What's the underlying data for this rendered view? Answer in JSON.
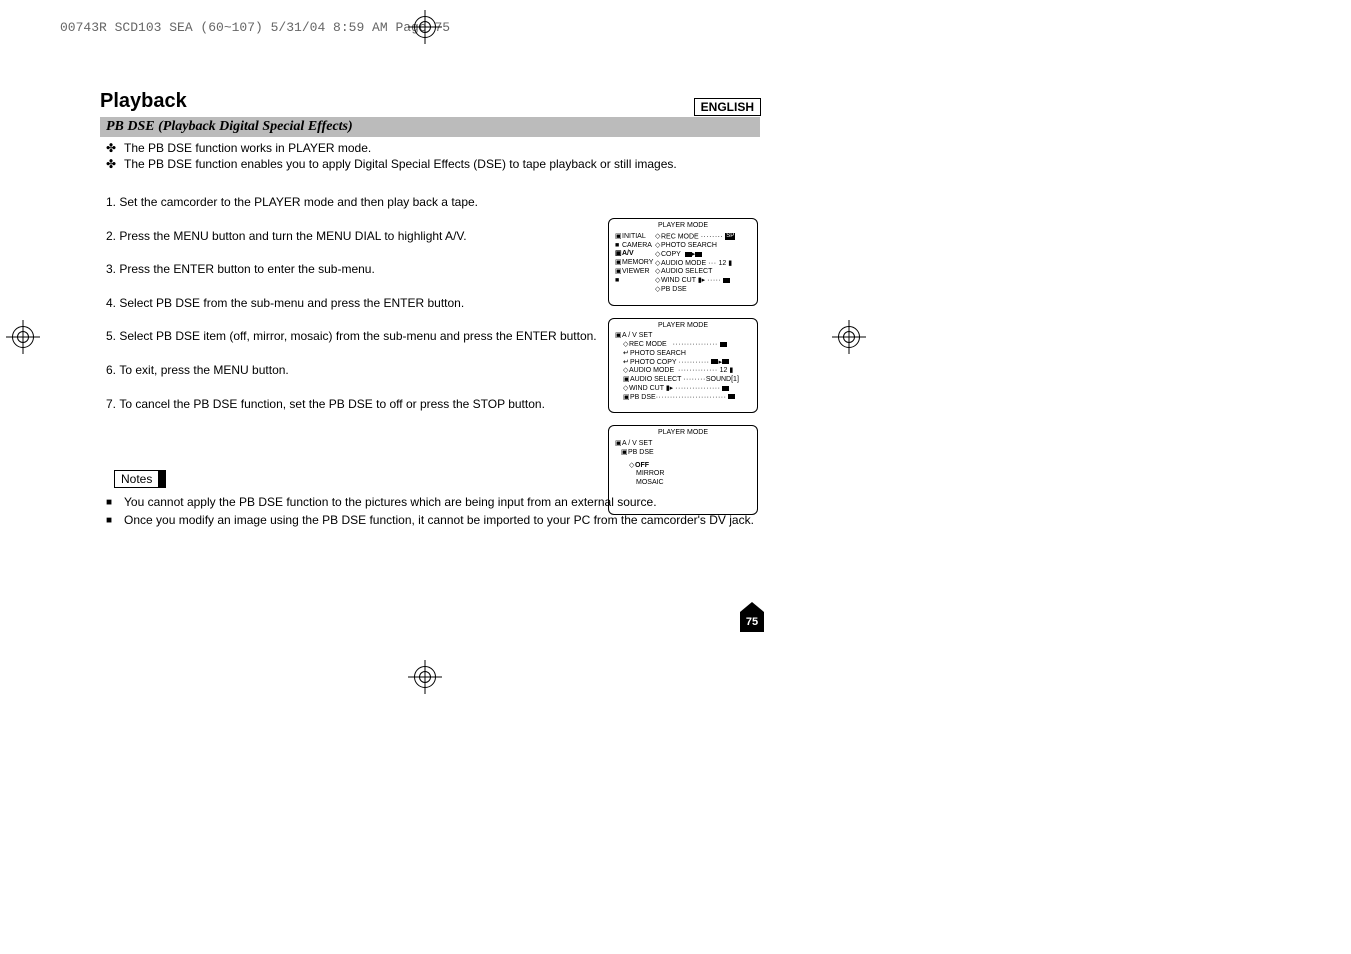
{
  "slug": "00743R SCD103 SEA (60~107)  5/31/04 8:59 AM  Page 75",
  "language": "ENGLISH",
  "page_title": "Playback",
  "sub_header": "PB DSE (Playback Digital Special Effects)",
  "intro": [
    "The PB DSE function works in PLAYER mode.",
    "The PB DSE function enables you to apply Digital Special Effects (DSE) to tape playback or still images."
  ],
  "steps": [
    "Set the camcorder to the PLAYER mode and then play back a tape.",
    "Press the MENU button and turn the MENU DIAL to highlight A/V.",
    "Press the ENTER button to enter the sub-menu.",
    "Select PB DSE from the sub-menu and press the ENTER button.",
    "Select PB DSE item (off, mirror, mosaic) from the sub-menu and press the ENTER button.",
    "To exit, press the MENU button.",
    "To cancel the PB DSE function, set the PB DSE to off or press the STOP button."
  ],
  "notes_label": "Notes",
  "notes": [
    "You cannot apply the PB DSE function to the pictures which are being input from an external source.",
    "Once you modify an image using the PB DSE function, it cannot be imported to your PC from the camcorder's DV jack."
  ],
  "page_number": "75",
  "osd": {
    "title": "PLAYER  MODE",
    "panel1": {
      "left": [
        "INITIAL",
        "CAMERA",
        "A/V",
        "MEMORY",
        "VIEWER"
      ],
      "right": [
        {
          "label": "REC MODE",
          "val": ""
        },
        {
          "label": "PHOTO SEARCH",
          "val": ""
        },
        {
          "label": "COPY",
          "val": ""
        },
        {
          "label": "AUDIO MODE",
          "val": "12"
        },
        {
          "label": "AUDIO SELECT",
          "val": ""
        },
        {
          "label": "WIND CUT",
          "val": ""
        },
        {
          "label": "PB DSE",
          "val": ""
        }
      ]
    },
    "panel2": {
      "head": "A / V SET",
      "rows": [
        {
          "label": "REC MODE",
          "val": ""
        },
        {
          "label": "PHOTO SEARCH",
          "val": ""
        },
        {
          "label": "PHOTO COPY",
          "val": ""
        },
        {
          "label": "AUDIO MODE",
          "val": "12"
        },
        {
          "label": "AUDIO SELECT",
          "val": "SOUND[1]"
        },
        {
          "label": "WIND CUT",
          "val": ""
        },
        {
          "label": "PB DSE",
          "val": ""
        }
      ]
    },
    "panel3": {
      "head": "A / V SET",
      "sub": "PB DSE",
      "options": [
        "OFF",
        "MIRROR",
        "MOSAIC"
      ]
    }
  }
}
